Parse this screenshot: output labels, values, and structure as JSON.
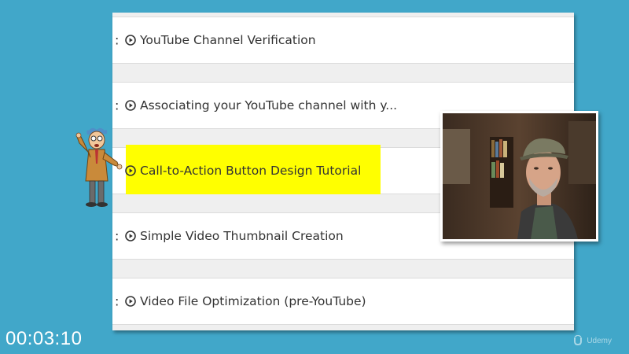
{
  "curriculum": {
    "lectures": [
      {
        "prefix": ":",
        "title": "YouTube Channel Verification"
      },
      {
        "prefix": ":",
        "title": "Associating your YouTube channel with y..."
      },
      {
        "prefix": ":",
        "title": "Call-to-Action Button Design Tutorial"
      },
      {
        "prefix": ":",
        "title": "Simple Video Thumbnail Creation"
      },
      {
        "prefix": ":",
        "title": "Video File Optimization (pre-YouTube)"
      }
    ],
    "highlighted_index": 2,
    "highlight_color": "#ffff00"
  },
  "video": {
    "timestamp": "00:03:10"
  },
  "watermark": {
    "brand": "Udemy"
  },
  "colors": {
    "background": "#41a7c9",
    "panel": "#ffffff",
    "gap": "#efefef",
    "text": "#333333"
  },
  "icons": {
    "lecture": "play-circle-icon",
    "watermark": "udemy-logo-icon"
  }
}
